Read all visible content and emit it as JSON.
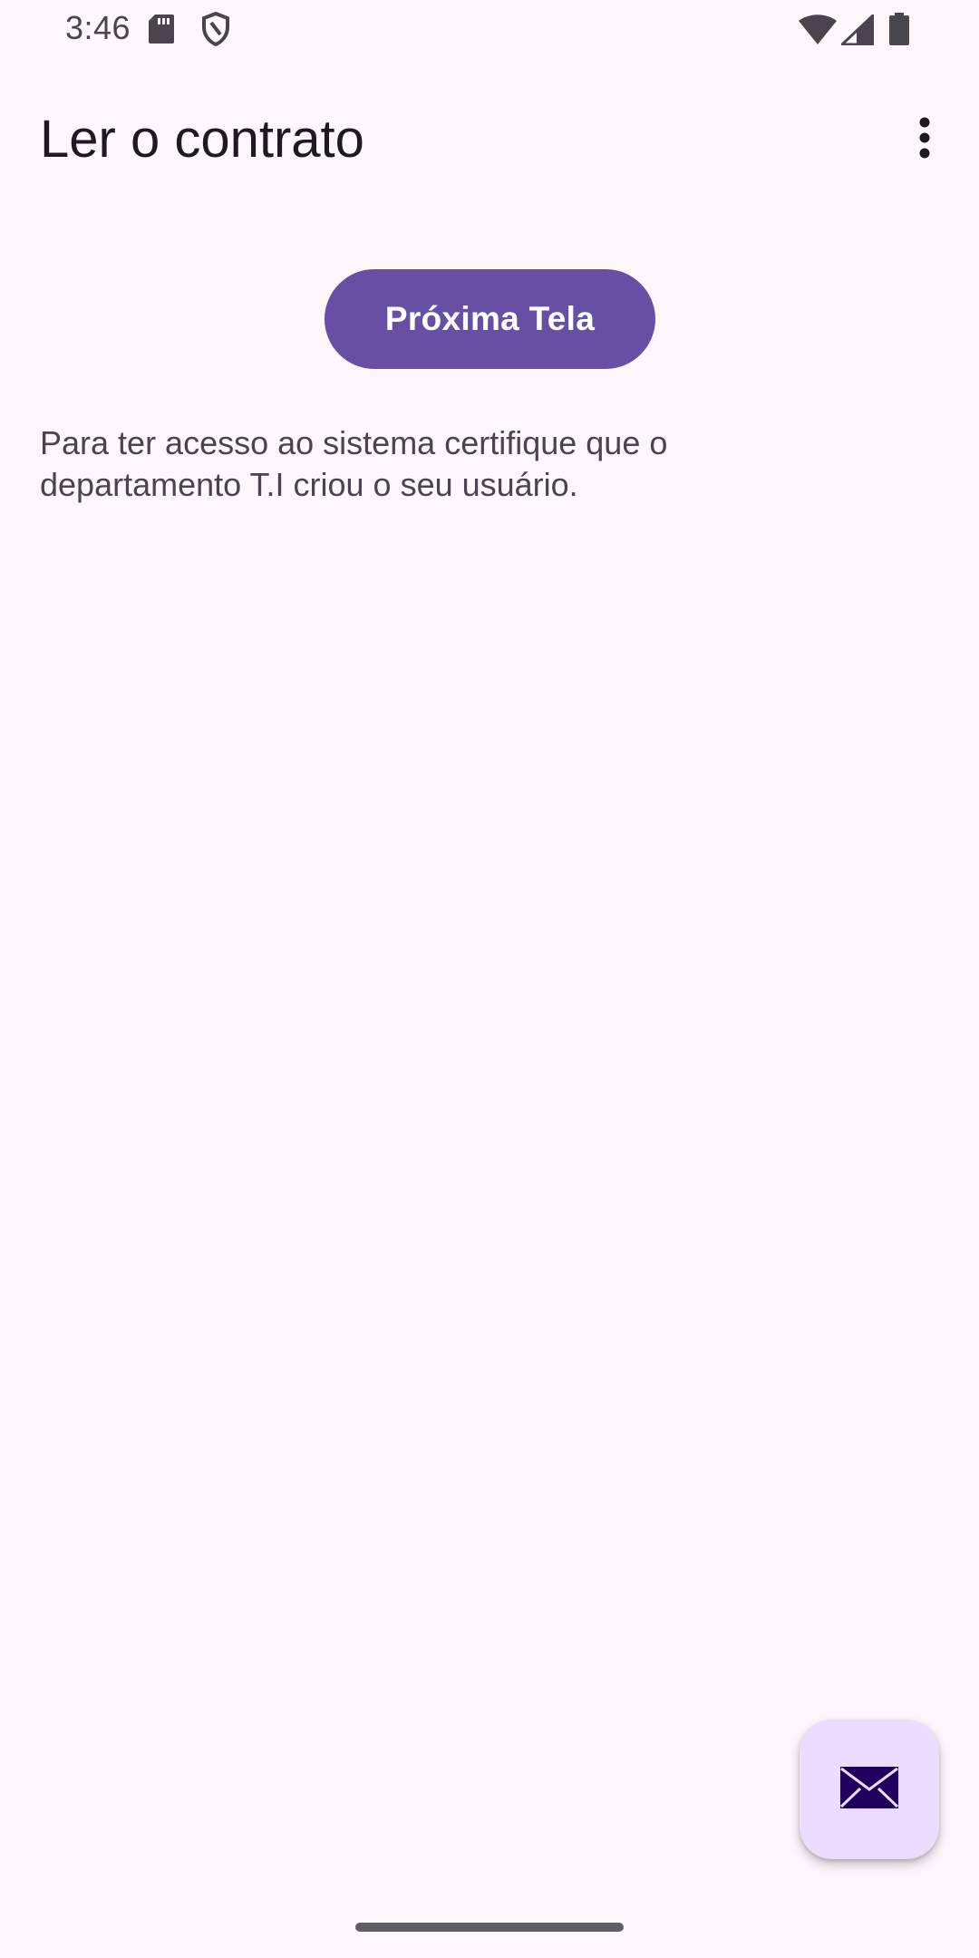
{
  "status_bar": {
    "time": "3:46",
    "icons": [
      "sd-card-icon",
      "shield-icon",
      "wifi-icon",
      "signal-icon",
      "battery-icon"
    ]
  },
  "app_bar": {
    "title": "Ler o contrato",
    "overflow_icon": "more-vert-icon"
  },
  "main": {
    "next_button_label": "Próxima Tela",
    "description": "Para ter acesso ao sistema certifique que o departamento T.I criou o seu usuário."
  },
  "fab": {
    "icon": "mail-icon"
  },
  "colors": {
    "background": "#fdf7fc",
    "primary": "#6750a4",
    "on_primary": "#ffffff",
    "fab_container": "#eaddff",
    "fab_icon": "#21005d",
    "text_primary": "#1d1b20",
    "text_secondary": "#49454f"
  }
}
